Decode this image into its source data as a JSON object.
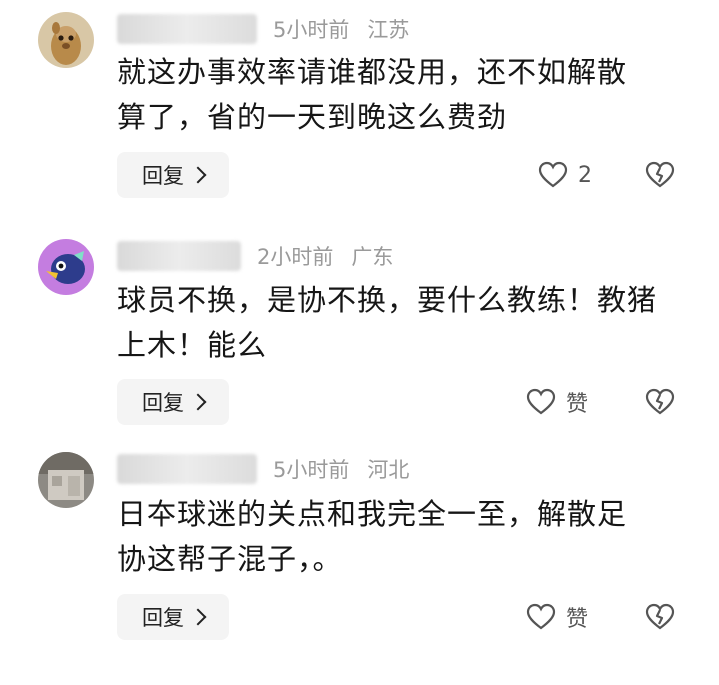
{
  "comments": [
    {
      "time": "5小时前",
      "location": "江苏",
      "text_line1": "就这办事效率请谁都没用，还不如解散",
      "text_line2": "算了，省的一天到晚这么费劲",
      "reply_label": "回复",
      "like_label": "2"
    },
    {
      "time": "2小时前",
      "location": "广东",
      "text_line1": "球员不换，是协不换，要什么教练！教猪",
      "text_line2": "上木！能么",
      "reply_label": "回复",
      "like_label": "赞"
    },
    {
      "time": "5小时前",
      "location": "河北",
      "text_line1": "日夲球迷的关点和我完全一至，解散足",
      "text_line2": "协这帮子混子，。",
      "reply_label": "回复",
      "like_label": "赞"
    }
  ],
  "icons": {
    "like": "heart-outline-icon",
    "dislike": "broken-heart-icon",
    "reply_chevron": "chevron-right-icon"
  },
  "colors": {
    "meta_text": "#9a9a9a",
    "body_text": "#161616",
    "reply_bg": "#f4f4f4",
    "icon": "#555555"
  }
}
